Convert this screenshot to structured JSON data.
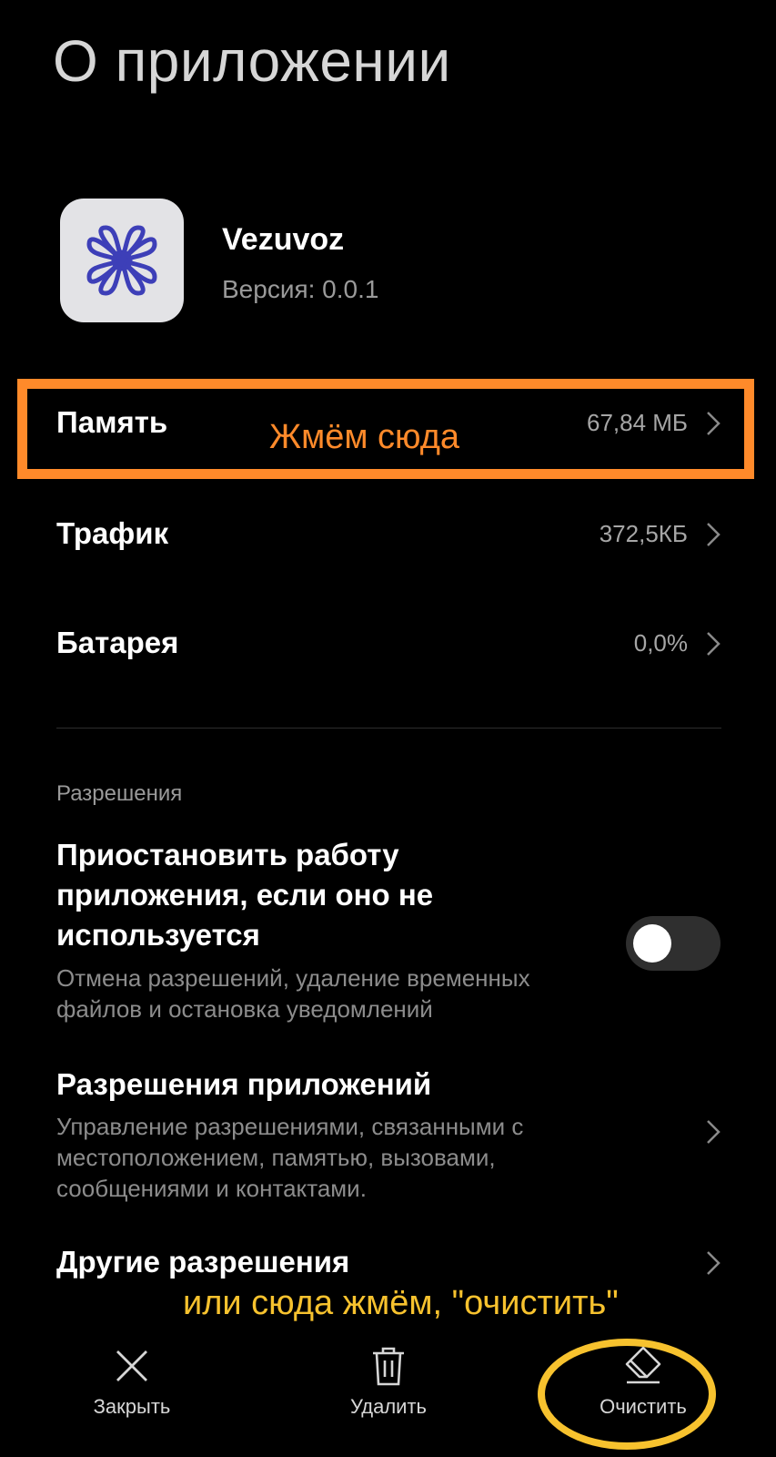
{
  "header": {
    "title": "О приложении"
  },
  "app": {
    "name": "Vezuvoz",
    "version": "Версия: 0.0.1",
    "icon": "app-logo-knot-icon"
  },
  "rows": [
    {
      "label": "Память",
      "value": "67,84 МБ"
    },
    {
      "label": "Трафик",
      "value": "372,5КБ"
    },
    {
      "label": "Батарея",
      "value": "0,0%"
    }
  ],
  "permissions": {
    "section_label": "Разрешения",
    "pause_app": {
      "title": "Приостановить работу приложения, если оно не используется",
      "description": "Отмена разрешений, удаление временных файлов и остановка уведомлений",
      "toggle_on": false
    },
    "app_permissions": {
      "title": "Разрешения приложений",
      "description": "Управление разрешениями, связанными с местоположением, памятью, вызовами, сообщениями и контактами."
    },
    "other_permissions": {
      "title": "Другие разрешения"
    }
  },
  "annotations": {
    "memory_hint": "Жмём сюда",
    "clear_hint": "или сюда жмём, \"очистить\""
  },
  "bottom_bar": {
    "close_label": "Закрыть",
    "delete_label": "Удалить",
    "clear_label": "Очистить"
  },
  "colors": {
    "background": "#000000",
    "orange_annotation": "#ff8a2a",
    "yellow_annotation": "#f7c22e",
    "logo_blue": "#3d3fb8"
  }
}
